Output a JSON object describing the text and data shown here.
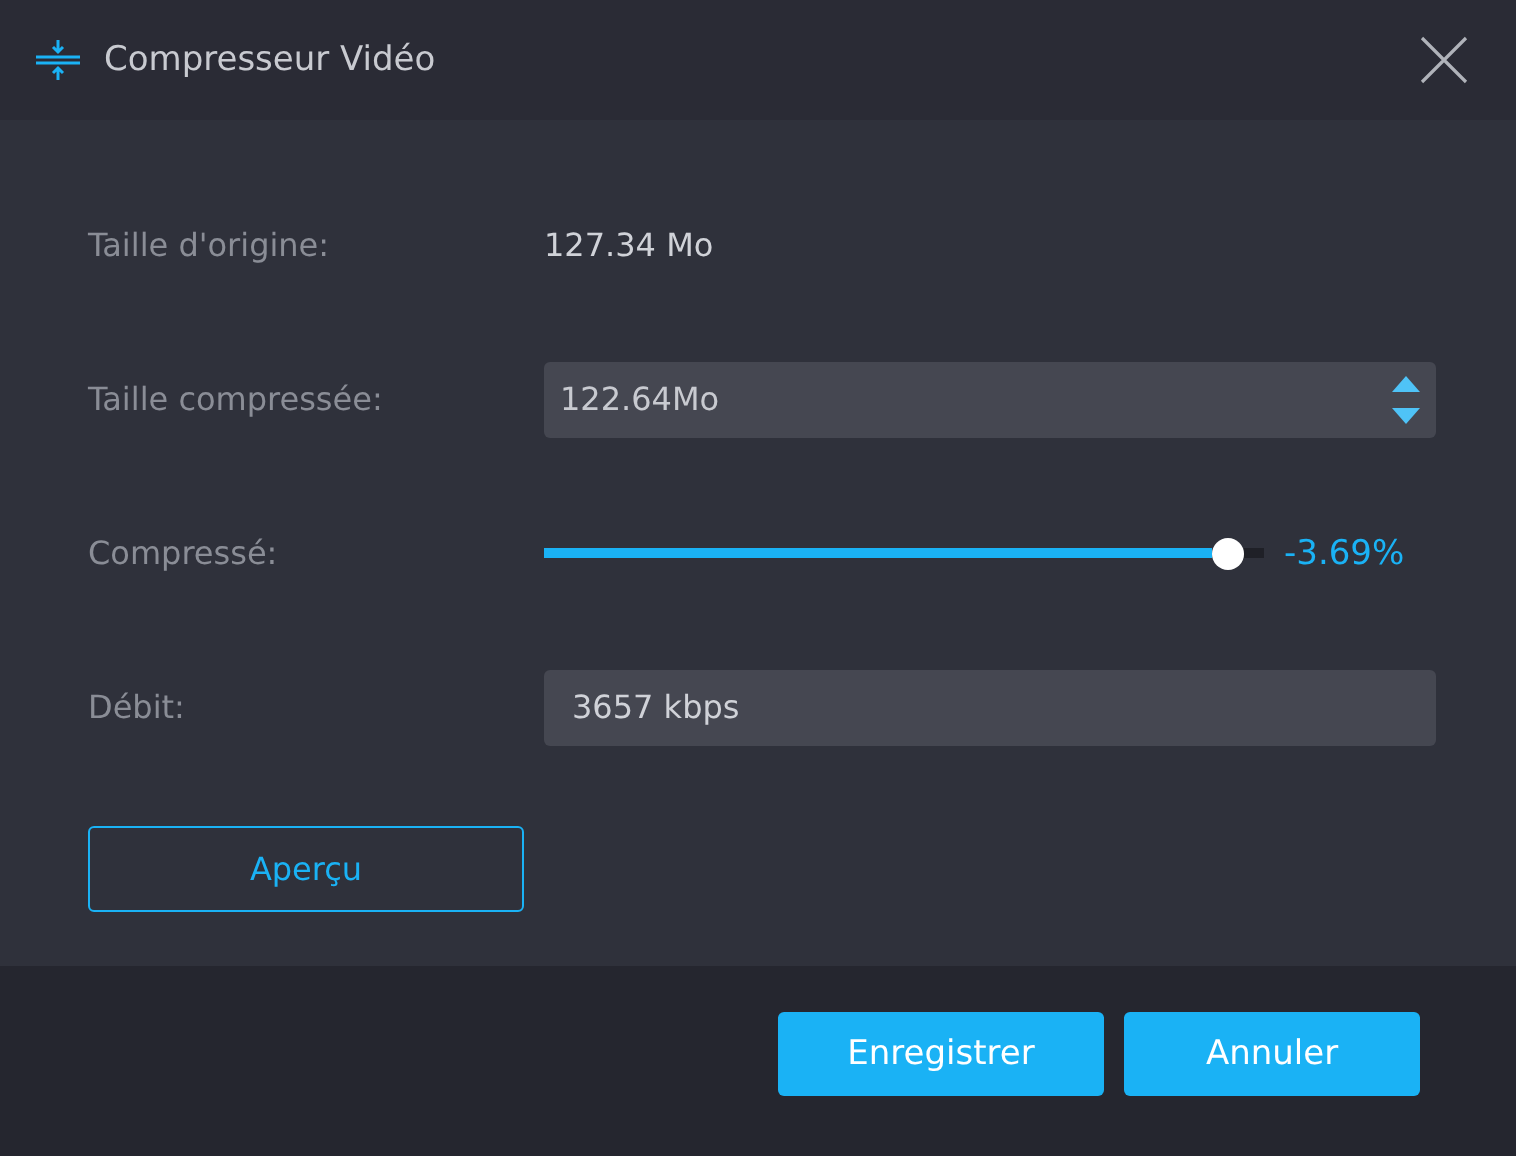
{
  "window": {
    "title": "Compresseur Vidéo"
  },
  "fields": [
    {
      "kind": "text",
      "label": "Taille d'origine:",
      "value": "127.34 Mo"
    },
    {
      "kind": "spin",
      "label": "Taille compressée:",
      "value": "122.64Mo"
    },
    {
      "kind": "slider",
      "label": "Compressé:",
      "level": 0.95,
      "reading": "-3.69%"
    },
    {
      "kind": "input",
      "label": "Débit:",
      "value": "3657 kbps"
    }
  ],
  "preview_button": "Aperçu",
  "buttons": [
    "Enregistrer",
    "Annuler"
  ]
}
